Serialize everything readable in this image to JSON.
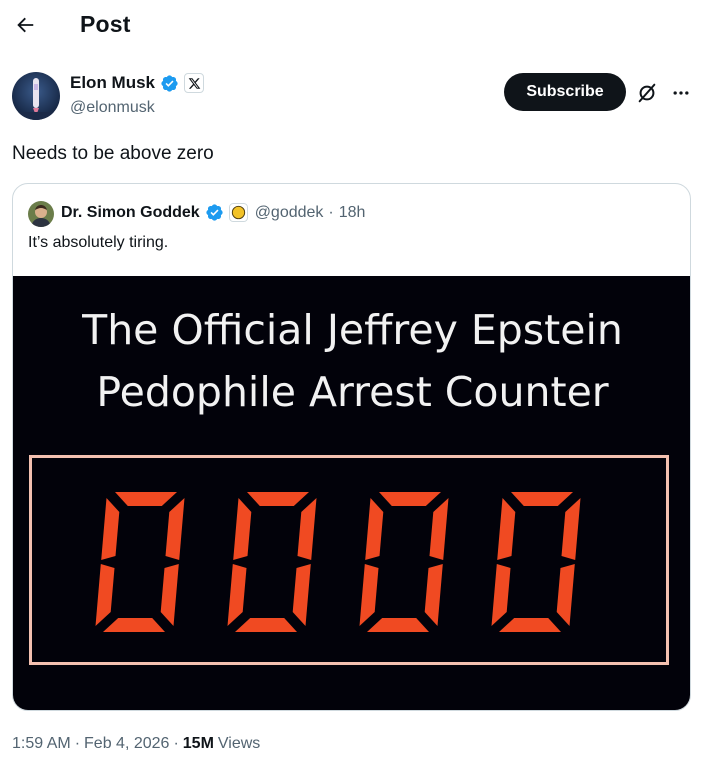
{
  "header": {
    "back_icon": "arrow-left-icon",
    "title": "Post"
  },
  "author": {
    "name": "Elon Musk",
    "handle": "@elonmusk",
    "verified_badge": "verified-check-icon",
    "affiliate_badge": "x-logo-icon",
    "verified_color": "#1d9bf0"
  },
  "actions": {
    "subscribe_label": "Subscribe",
    "grok_icon": "grok-icon",
    "more_icon": "more-dots-icon"
  },
  "post": {
    "text": "Needs to be above zero"
  },
  "quoted_post": {
    "name": "Dr. Simon Goddek",
    "handle": "@goddek",
    "separator": "·",
    "time": "18h",
    "text": "It’s absolutely tiring.",
    "media": {
      "title_line1": "The Official Jeffrey Epstein",
      "title_line2": "Pedophile Arrest Counter",
      "counter_value": "0000",
      "digit_color": "#f04a22"
    }
  },
  "meta": {
    "time": "1:59 AM",
    "dot1": "·",
    "date": "Feb 4, 2026",
    "dot2": "·",
    "views_count": "15M",
    "views_label": "Views"
  }
}
